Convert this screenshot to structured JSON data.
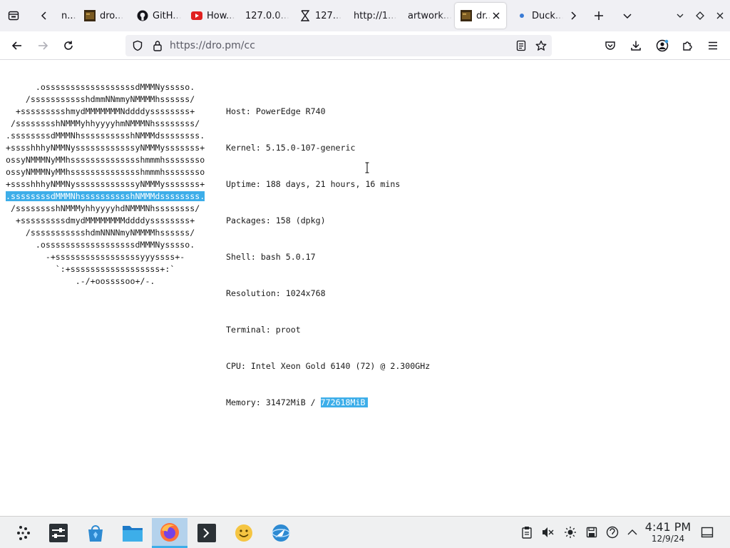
{
  "browser": {
    "tabs": [
      {
        "title": "n...",
        "favicon": "page-icon"
      },
      {
        "title": "dro...",
        "favicon": "terminal-favicon"
      },
      {
        "title": "GitH...",
        "favicon": "github-icon"
      },
      {
        "title": "How...",
        "favicon": "youtube-favicon"
      },
      {
        "title": "127.0.0...",
        "favicon": "none"
      },
      {
        "title": "127...",
        "favicon": "hourglass-icon"
      },
      {
        "title": "http://1...",
        "favicon": "none"
      },
      {
        "title": "artwork...",
        "favicon": "none"
      },
      {
        "title": "dr...",
        "favicon": "terminal-favicon",
        "active": true
      },
      {
        "title": "Duck...",
        "favicon": "dot-icon"
      }
    ],
    "url": "https://dro.pm/cc"
  },
  "page": {
    "ascii_art": [
      "      .ossssssssssssssssssdMMMNysssso.",
      "    /ssssssssssshdmmNNmmyNMMMMhssssss/",
      "  +ssssssssshmydMMMMMMMNddddyssssssss+",
      " /sssssssshNMMMyhhyyyyhmNMMMNhssssssss/",
      ".ssssssssdMMMNhsssssssssshNMMMdssssssss.",
      "+sssshhhyNMMNyssssssssssssyNMMMysssssss+",
      "ossyNMMMNyMMhsssssssssssssshmmmhssssssso",
      "ossyNMMMNyMMhsssssssssssssshmmmhssssssso",
      "+sssshhhyNMMNyssssssssssssyNMMMysssssss+",
      ".ssssssssdMMMNhsssssssssshNMMMdssssssss.",
      " /sssssssshNMMMyhhyyyyhdNMMMNhssssssss/",
      "  +sssssssssdmydMMMMMMMMddddyssssssss+",
      "    /ssssssssssshdmNNNNmyNMMMMhssssss/",
      "      .ossssssssssssssssssdMMMNysssso.",
      "        -+sssssssssssssssssyyyssss+-",
      "          `:+ssssssssssssssssss+:`",
      "              .-/+oossssoo+/-."
    ],
    "selected_ascii_line": 9,
    "info_lines": [
      "Host: PowerEdge R740",
      "Kernel: 5.15.0-107-generic",
      "Uptime: 188 days, 21 hours, 16 mins",
      "Packages: 158 (dpkg)",
      "Shell: bash 5.0.17",
      "Resolution: 1024x768",
      "Terminal: proot",
      "CPU: Intel Xeon Gold 6140 (72) @ 2.300GHz"
    ],
    "memory_prefix": "Memory: 31472MiB / ",
    "memory_total": "772618MiB"
  },
  "taskbar": {
    "apps": [
      "app-launcher-icon",
      "system-settings-icon",
      "discover-store-icon",
      "file-manager-icon",
      "firefox-icon",
      "terminal-icon",
      "smiley-app-icon",
      "web-browser-icon"
    ],
    "tray": [
      "clipboard-icon",
      "volume-muted-icon",
      "brightness-icon",
      "save-icon",
      "updates-icon",
      "tray-expand-icon"
    ],
    "clock_time": "4:41 PM",
    "clock_date": "12/9/24"
  }
}
